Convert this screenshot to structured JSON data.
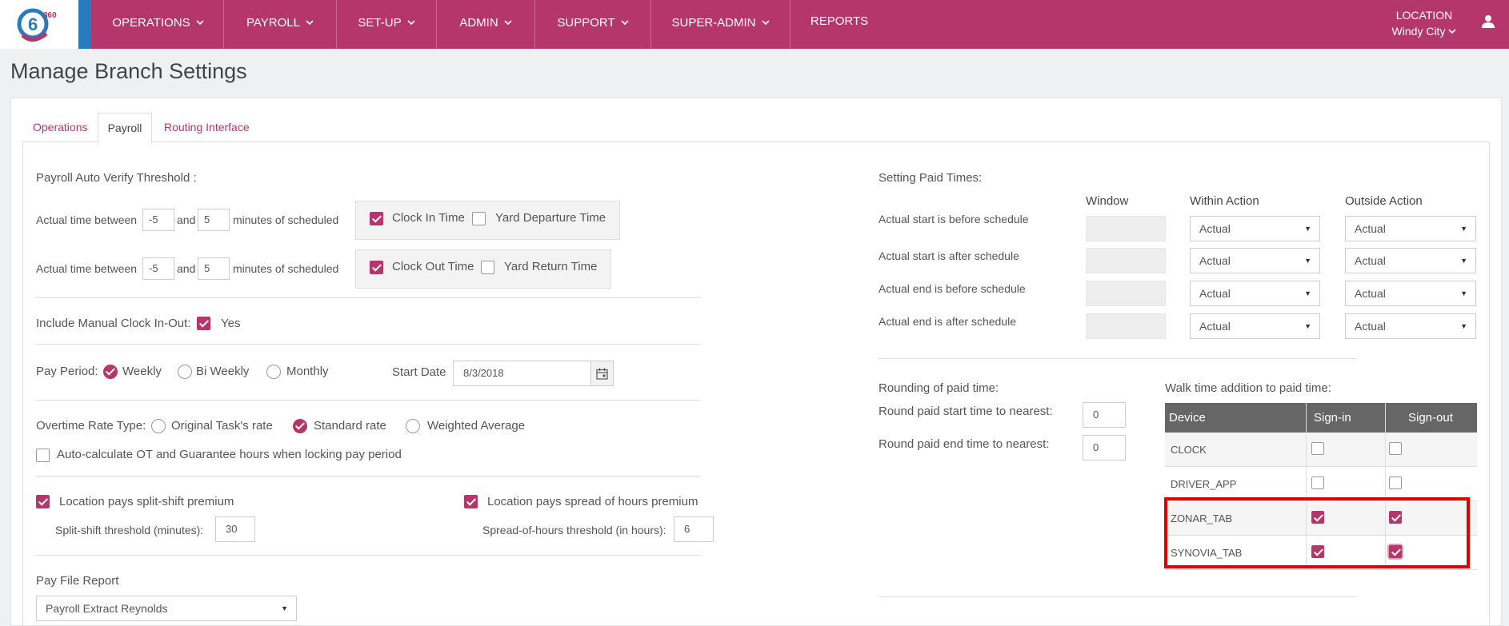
{
  "nav": {
    "items": [
      "OPERATIONS",
      "PAYROLL",
      "SET-UP",
      "ADMIN",
      "SUPPORT",
      "SUPER-ADMIN",
      "REPORTS"
    ],
    "logo_text": "360",
    "location_label": "LOCATION",
    "location_value": "Windy City"
  },
  "page": {
    "title": "Manage Branch Settings"
  },
  "tabs": [
    "Operations",
    "Payroll",
    "Routing Interface"
  ],
  "auto_verify": {
    "title": "Payroll Auto Verify Threshold :",
    "between_label": "Actual time between",
    "and_label": "and",
    "minutes_label": "minutes of scheduled",
    "row1": {
      "from": "-5",
      "to": "5",
      "opt1": "Clock In Time",
      "opt1_checked": true,
      "opt2": "Yard Departure Time",
      "opt2_checked": false
    },
    "row2": {
      "from": "-5",
      "to": "5",
      "opt1": "Clock Out Time",
      "opt1_checked": true,
      "opt2": "Yard Return Time",
      "opt2_checked": false
    }
  },
  "manual_clock": {
    "label": "Include Manual Clock In-Out:",
    "option": "Yes",
    "checked": true
  },
  "pay_period": {
    "label": "Pay Period:",
    "options": [
      "Weekly",
      "Bi Weekly",
      "Monthly"
    ],
    "selected": "Weekly",
    "start_date_label": "Start Date",
    "start_date": "8/3/2018"
  },
  "overtime": {
    "label": "Overtime Rate Type:",
    "options": [
      "Original Task's rate",
      "Standard rate",
      "Weighted Average"
    ],
    "selected": "Standard rate",
    "auto_calc_label": "Auto-calculate OT and Guarantee hours when locking pay period",
    "auto_calc_checked": false
  },
  "premiums": {
    "split_label": "Location pays split-shift premium",
    "split_checked": true,
    "split_threshold_label": "Split-shift threshold (minutes):",
    "split_threshold": "30",
    "spread_label": "Location pays spread of hours premium",
    "spread_checked": true,
    "spread_threshold_label": "Spread-of-hours threshold (in hours):",
    "spread_threshold": "6"
  },
  "pay_file": {
    "label": "Pay File Report",
    "value": "Payroll Extract Reynolds"
  },
  "paid_times": {
    "title": "Setting Paid Times:",
    "headers": [
      "Window",
      "Within Action",
      "Outside Action"
    ],
    "rows": [
      {
        "label": "Actual start is before schedule",
        "window": "",
        "within": "Actual",
        "outside": "Actual"
      },
      {
        "label": "Actual start is after schedule",
        "window": "",
        "within": "Actual",
        "outside": "Actual"
      },
      {
        "label": "Actual end is before schedule",
        "window": "",
        "within": "Actual",
        "outside": "Actual"
      },
      {
        "label": "Actual end is after schedule",
        "window": "",
        "within": "Actual",
        "outside": "Actual"
      }
    ]
  },
  "rounding": {
    "title": "Rounding of paid time:",
    "start_label": "Round paid start time to nearest:",
    "start_value": "0",
    "end_label": "Round paid end time to nearest:",
    "end_value": "0"
  },
  "walk_time": {
    "title": "Walk time addition to paid time:",
    "headers": [
      "Device",
      "Sign-in",
      "Sign-out"
    ],
    "rows": [
      {
        "device": "CLOCK",
        "sign_in": false,
        "sign_out": false
      },
      {
        "device": "DRIVER_APP",
        "sign_in": false,
        "sign_out": false
      },
      {
        "device": "ZONAR_TAB",
        "sign_in": true,
        "sign_out": true
      },
      {
        "device": "SYNOVIA_TAB",
        "sign_in": true,
        "sign_out": true
      }
    ]
  },
  "colors": {
    "brand": "#b5366a",
    "accent_stripe": "#2a7bbd",
    "highlight": "#e00000",
    "grid_header": "#666666"
  }
}
